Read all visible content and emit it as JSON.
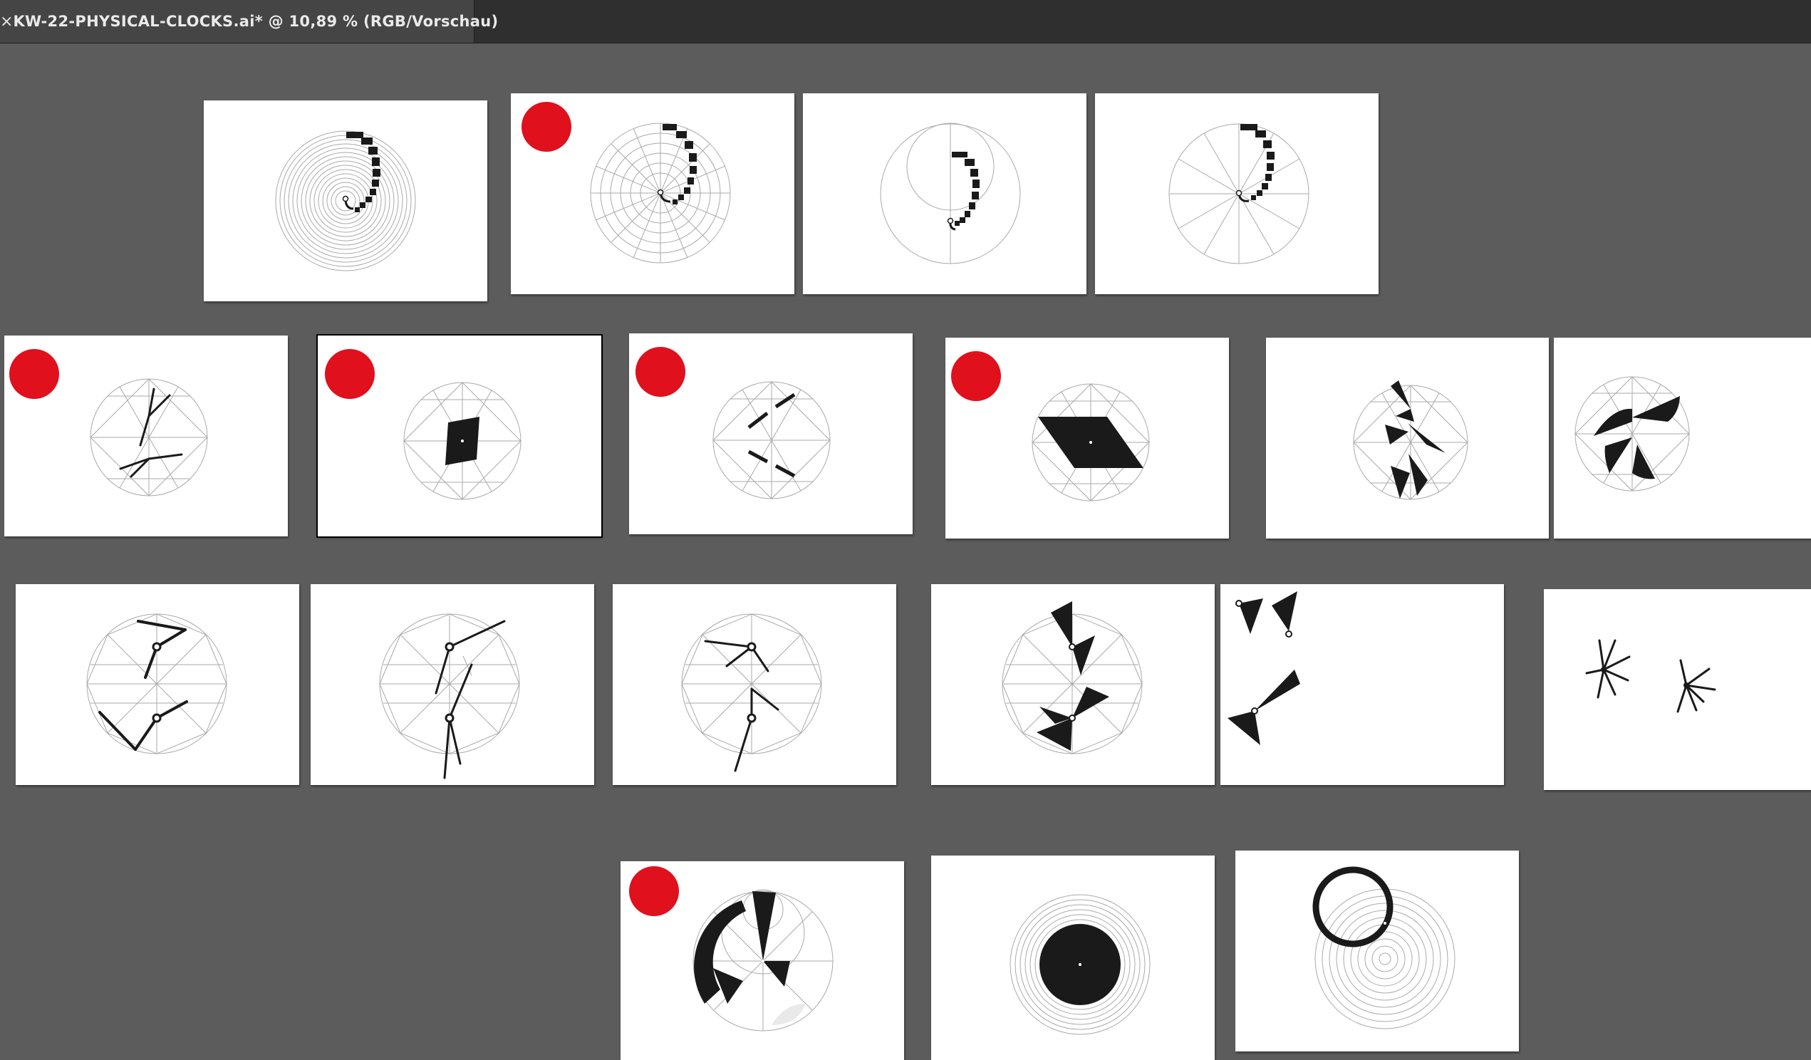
{
  "document_tab": {
    "close_glyph": "×",
    "title": "KW-22-PHYSICAL-CLOCKS.ai* @ 10,89 % (RGB/Vorschau)"
  },
  "colors": {
    "workspace": "#5c5c5c",
    "artboard": "#ffffff",
    "marker_dot": "#e0101d",
    "ink": "#1a1a1a",
    "guide_line": "#a8a8a8"
  },
  "artboards": [
    {
      "id": "a1",
      "design": "spiral-rings"
    },
    {
      "id": "a2",
      "design": "polar-grid-spiral",
      "marked": true
    },
    {
      "id": "a3",
      "design": "inner-circle-spiral"
    },
    {
      "id": "a4",
      "design": "spoke-spiral"
    },
    {
      "id": "a5",
      "design": "double-hands",
      "marked": true
    },
    {
      "id": "a6",
      "design": "diamond-center",
      "marked": true,
      "selected": true
    },
    {
      "id": "a7",
      "design": "bar-pairs",
      "marked": true
    },
    {
      "id": "a8",
      "design": "parallelogram",
      "marked": true
    },
    {
      "id": "a9",
      "design": "triangles-bowtie"
    },
    {
      "id": "a10",
      "design": "wedge-cluster"
    },
    {
      "id": "a11",
      "design": "two-clocks-hands"
    },
    {
      "id": "a12",
      "design": "two-clocks-long-hands"
    },
    {
      "id": "a13",
      "design": "two-clocks-hands-b"
    },
    {
      "id": "a14",
      "design": "two-clocks-wedges"
    },
    {
      "id": "a15",
      "design": "floating-wedges"
    },
    {
      "id": "a16",
      "design": "starbursts"
    },
    {
      "id": "a17",
      "design": "moon-phases",
      "marked": true
    },
    {
      "id": "a18",
      "design": "filled-disc"
    },
    {
      "id": "a19",
      "design": "ring-over-target"
    }
  ]
}
